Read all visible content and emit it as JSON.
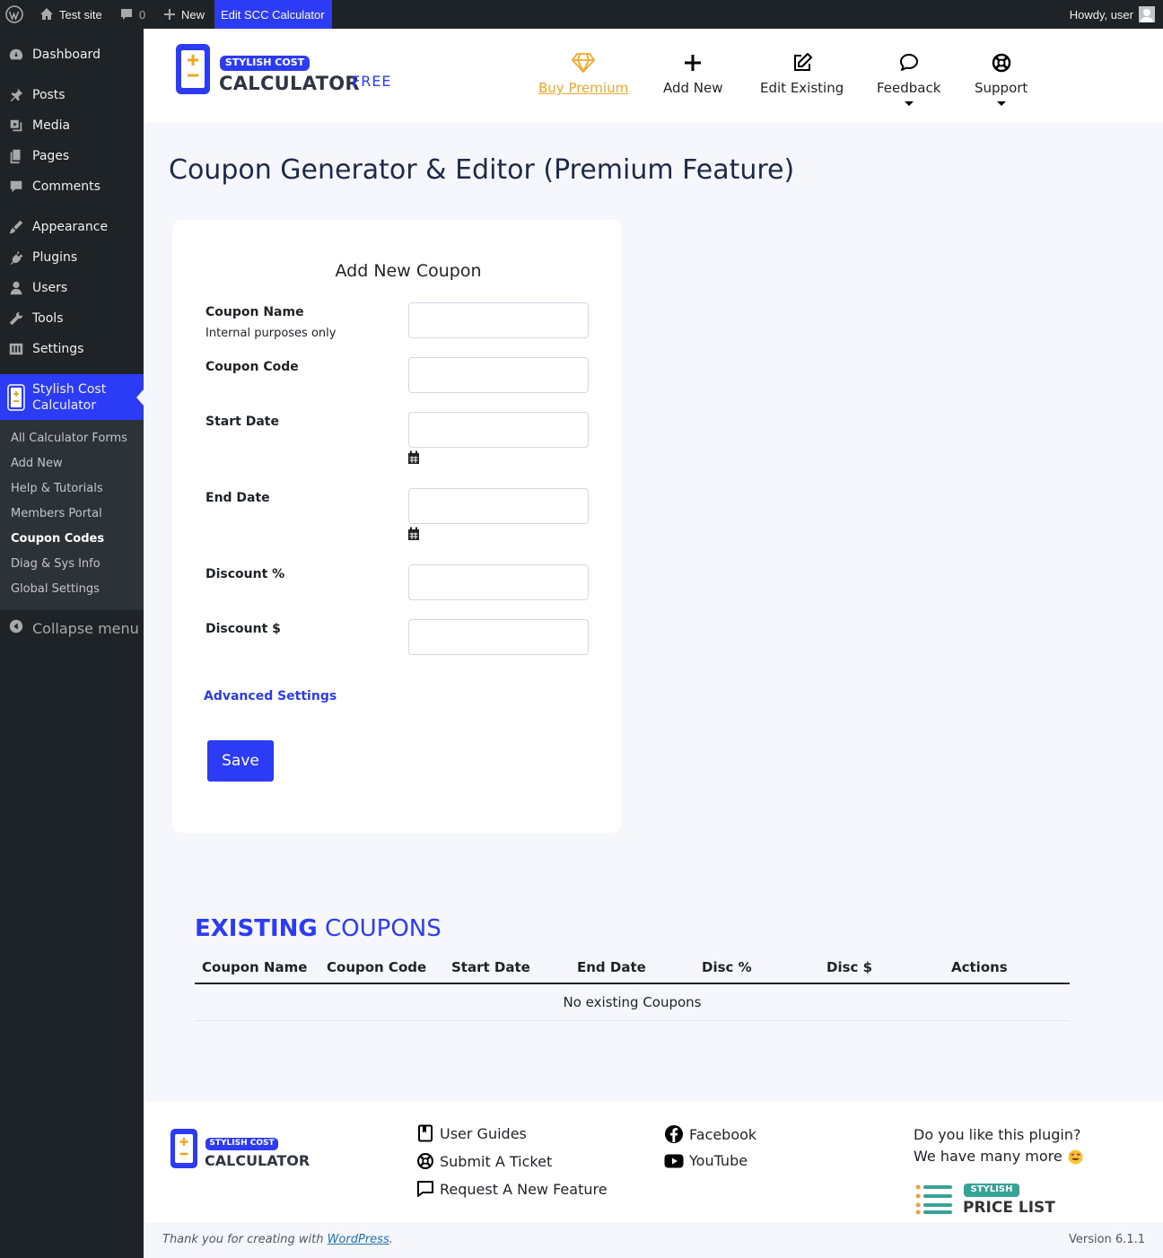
{
  "admin_bar": {
    "site_name": "Test site",
    "comments_count": "0",
    "new_label": "New",
    "edit_label": "Edit SCC Calculator",
    "howdy": "Howdy, user"
  },
  "sidebar": {
    "items": [
      {
        "label": "Dashboard",
        "icon": "dashboard-icon"
      },
      {
        "label": "Posts",
        "icon": "pin-icon"
      },
      {
        "label": "Media",
        "icon": "media-icon"
      },
      {
        "label": "Pages",
        "icon": "pages-icon"
      },
      {
        "label": "Comments",
        "icon": "comment-icon"
      },
      {
        "label": "Appearance",
        "icon": "brush-icon"
      },
      {
        "label": "Plugins",
        "icon": "plugin-icon"
      },
      {
        "label": "Users",
        "icon": "user-icon"
      },
      {
        "label": "Tools",
        "icon": "wrench-icon"
      },
      {
        "label": "Settings",
        "icon": "settings-icon"
      }
    ],
    "active_menu": {
      "line1": "Stylish Cost",
      "line2": "Calculator"
    },
    "submenu": [
      {
        "label": "All Calculator Forms"
      },
      {
        "label": "Add New"
      },
      {
        "label": "Help & Tutorials"
      },
      {
        "label": "Members Portal"
      },
      {
        "label": "Coupon Codes"
      },
      {
        "label": "Diag & Sys Info"
      },
      {
        "label": "Global Settings"
      }
    ],
    "collapse_label": "Collapse menu"
  },
  "header": {
    "logo_badge": "STYLISH COST",
    "logo_text": "CALCULATOR",
    "edition": "FREE",
    "nav": {
      "buy_premium": "Buy Premium",
      "add_new": "Add New",
      "edit_existing": "Edit Existing",
      "feedback": "Feedback",
      "support": "Support"
    }
  },
  "page_title": "Coupon Generator & Editor (Premium Feature)",
  "coupon_form": {
    "title": "Add New Coupon",
    "fields": {
      "coupon_name": {
        "label": "Coupon Name",
        "hint": "Internal purposes only",
        "value": ""
      },
      "coupon_code": {
        "label": "Coupon Code",
        "value": ""
      },
      "start_date": {
        "label": "Start Date",
        "value": ""
      },
      "end_date": {
        "label": "End Date",
        "value": ""
      },
      "discount_percent": {
        "label": "Discount %",
        "value": ""
      },
      "discount_dollar": {
        "label": "Discount $",
        "value": ""
      }
    },
    "advanced_settings": "Advanced Settings",
    "save": "Save"
  },
  "existing": {
    "title_strong": "EXISTING",
    "title_rest": "COUPONS",
    "columns": [
      "Coupon Name",
      "Coupon Code",
      "Start Date",
      "End Date",
      "Disc %",
      "Disc $",
      "Actions"
    ],
    "empty_message": "No existing Coupons"
  },
  "footer": {
    "logo_badge": "STYLISH COST",
    "logo_text": "CALCULATOR",
    "links": {
      "user_guides": "User Guides",
      "submit_ticket": "Submit A Ticket",
      "request_feature": "Request A New Feature",
      "facebook": "Facebook",
      "youtube": "YouTube"
    },
    "promo_line1": "Do you like this plugin?",
    "promo_line2": "We have many more",
    "pricelist_badge": "STYLISH",
    "pricelist_text": "PRICE LIST"
  },
  "wp_footer": {
    "thanks_prefix": "Thank you for creating with ",
    "wordpress_link": "WordPress",
    "thanks_suffix": ".",
    "version": "Version 6.1.1"
  },
  "colors": {
    "accent": "#2c3bf5",
    "premium": "#f5a623",
    "admin_dark": "#1d2327"
  }
}
